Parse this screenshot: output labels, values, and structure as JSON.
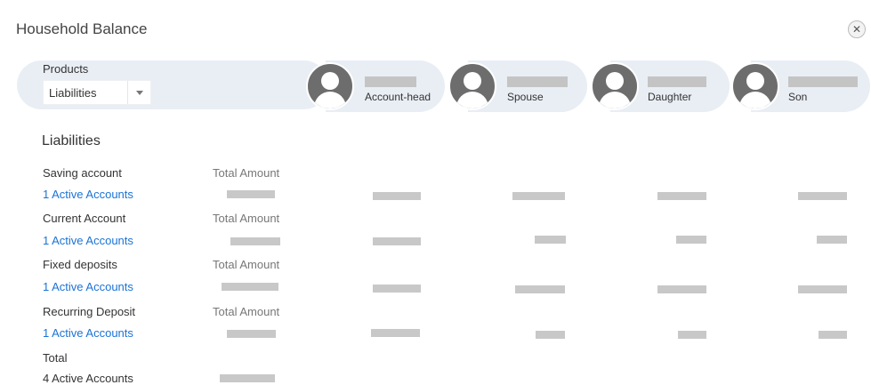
{
  "dialog": {
    "title": "Household Balance",
    "close_icon": "close-icon"
  },
  "products": {
    "label": "Products",
    "selected": "Liabilities"
  },
  "members": [
    {
      "role": "Account-head"
    },
    {
      "role": "Spouse"
    },
    {
      "role": "Daughter"
    },
    {
      "role": "Son"
    }
  ],
  "section": {
    "heading": "Liabilities"
  },
  "rows": [
    {
      "name": "Saving account",
      "link": "1 Active Accounts",
      "total_label": "Total Amount"
    },
    {
      "name": "Current Account",
      "link": "1 Active Accounts",
      "total_label": "Total Amount"
    },
    {
      "name": "Fixed deposits",
      "link": "1 Active Accounts",
      "total_label": "Total Amount"
    },
    {
      "name": "Recurring Deposit",
      "link": "1 Active Accounts",
      "total_label": "Total Amount"
    }
  ],
  "total": {
    "label": "Total",
    "accounts": "4 Active Accounts"
  },
  "colors": {
    "link": "#1a73d6",
    "pill": "#e9eef5",
    "redacted": "#c8c8c8"
  }
}
